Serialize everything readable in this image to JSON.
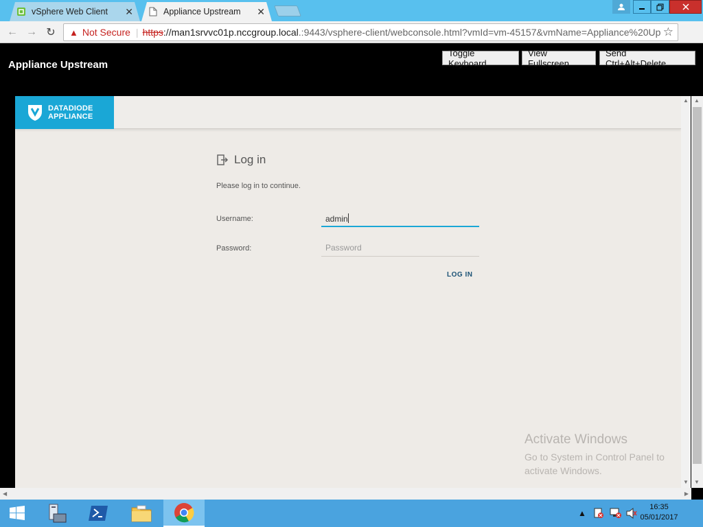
{
  "browser": {
    "tabs": [
      {
        "label": "vSphere Web Client",
        "active": false
      },
      {
        "label": "Appliance Upstream",
        "active": true
      }
    ],
    "url": {
      "security_label": "Not Secure",
      "scheme": "https",
      "rest_host": "://man1srvvc01p.nccgroup.local",
      "rest_path": ".:9443/vsphere-client/webconsole.html?vmId=vm-45157&vmName=Appliance%20Up"
    }
  },
  "console": {
    "title": "Appliance Upstream",
    "buttons": {
      "toggle_keyboard": "Toggle Keyboard",
      "view_fullscreen": "View Fullscreen",
      "send_cad": "Send Ctrl+Alt+Delete"
    }
  },
  "app": {
    "logo_line1": "DATADIODE",
    "logo_line2": "APPLIANCE",
    "brand_color": "#1aa7d6"
  },
  "login": {
    "title": "Log in",
    "subtitle": "Please log in to continue.",
    "username_label": "Username:",
    "username_value": "admin",
    "password_label": "Password:",
    "password_placeholder": "Password",
    "submit_label": "LOG IN"
  },
  "watermark": {
    "line1": "Activate Windows",
    "line2": "Go to System in Control Panel to",
    "line3": "activate Windows."
  },
  "taskbar": {
    "time": "16:35",
    "date": "05/01/2017"
  }
}
